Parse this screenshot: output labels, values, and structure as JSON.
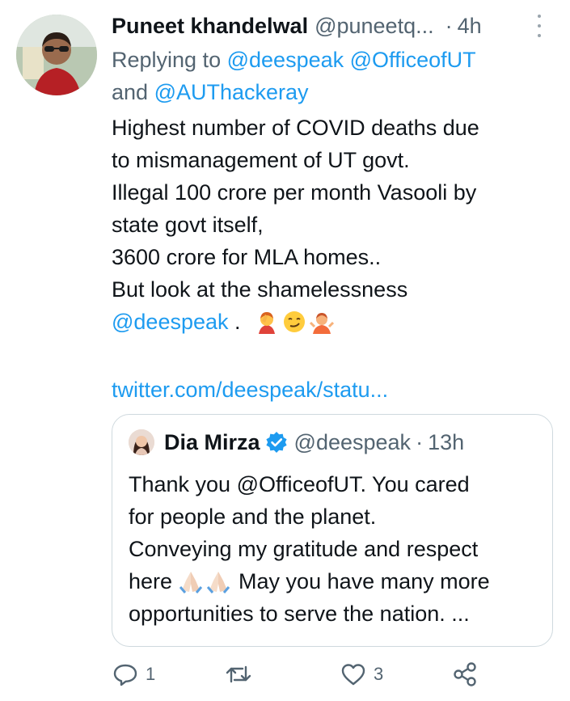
{
  "tweet": {
    "author_name": "Puneet khandelwal",
    "author_handle": "@puneetq...",
    "separator": "·",
    "time": "4h",
    "reply_prefix": "Replying to",
    "reply_mentions": [
      "@deespeak",
      "@OfficeofUT"
    ],
    "reply_and": "and",
    "reply_mention_last": "@AUThackeray",
    "body_lines": [
      "Highest number of COVID deaths due",
      "to mismanagement of UT govt.",
      "Illegal 100 crore per month Vasooli by",
      "state govt itself,",
      "3600 crore for MLA homes..",
      "But look at the shamelessness"
    ],
    "body_last_mention": "@deespeak",
    "body_last_punct": ".",
    "emojis": [
      "facepalm-emoji",
      "smirk-emoji",
      "shrug-emoji"
    ],
    "link": "twitter.com/deespeak/statu..."
  },
  "quote": {
    "author_name": "Dia Mirza",
    "author_handle": "@deespeak",
    "separator": "·",
    "time": "13h",
    "lines": [
      "Thank you @OfficeofUT. You cared",
      "for people and the planet.",
      "Conveying my gratitude and respect"
    ],
    "line4_before": "here",
    "line4_after": "May you have many more",
    "line5": "opportunities to serve the nation.",
    "ellipsis": "...",
    "emojis": [
      "folded-hands-emoji",
      "folded-hands-emoji"
    ]
  },
  "actions": {
    "reply_count": "1",
    "retweet_count": "",
    "like_count": "3"
  },
  "colors": {
    "link_blue": "#1d9bf0",
    "text_primary": "#0f1419",
    "text_secondary": "#536471",
    "border": "#cfd9de"
  }
}
